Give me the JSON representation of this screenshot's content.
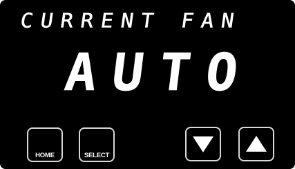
{
  "display": {
    "header": "CURRENT FAN",
    "value": "AUTO"
  },
  "buttons": {
    "home_label": "HOME",
    "select_label": "SELECT",
    "down_icon": "triangle-down",
    "up_icon": "triangle-up"
  },
  "colors": {
    "background": "#000000",
    "segment": "#ffffff",
    "button_border": "#d8d8d8"
  }
}
